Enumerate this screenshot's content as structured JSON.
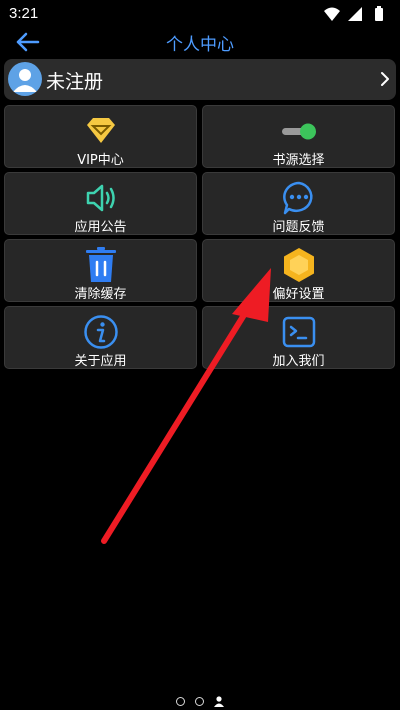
{
  "status_bar": {
    "time": "3:21",
    "icons": [
      "wifi-icon",
      "signal-icon",
      "battery-icon"
    ]
  },
  "app_bar": {
    "back_icon": "arrow-left-icon",
    "title": "个人中心"
  },
  "user_card": {
    "name": "未注册",
    "avatar_icon": "user-avatar-icon",
    "chevron_icon": "chevron-right-icon"
  },
  "grid": {
    "items": [
      {
        "label": "VIP中心",
        "icon": "diamond-icon"
      },
      {
        "label": "书源选择",
        "icon": "toggle-icon"
      },
      {
        "label": "应用公告",
        "icon": "speaker-icon"
      },
      {
        "label": "问题反馈",
        "icon": "chat-bubble-icon"
      },
      {
        "label": "清除缓存",
        "icon": "trash-icon"
      },
      {
        "label": "偏好设置",
        "icon": "hexagon-icon"
      },
      {
        "label": "关于应用",
        "icon": "info-icon"
      },
      {
        "label": "加入我们",
        "icon": "terminal-icon"
      }
    ]
  },
  "pager": {
    "pages": 3,
    "active_index": 2,
    "active_icon": "person-icon"
  },
  "colors": {
    "background": "#000000",
    "accent": "#4e9cff",
    "tile": "#272727",
    "annotation_arrow": "#ee1c24"
  }
}
